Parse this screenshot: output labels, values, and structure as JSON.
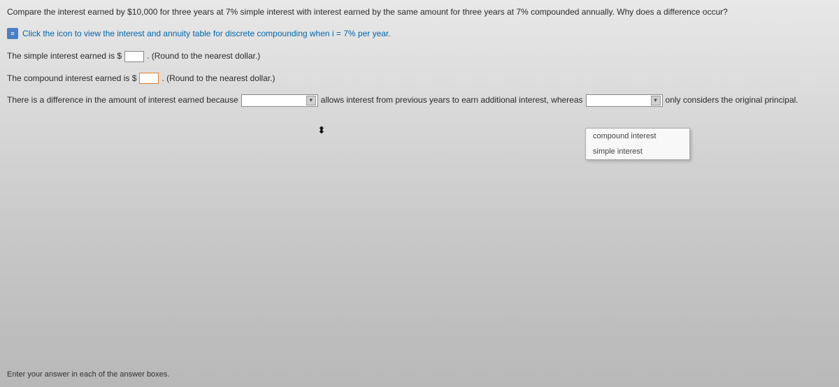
{
  "question": "Compare the interest earned by $10,000 for three years at 7% simple interest with interest earned by the same amount for three years at 7% compounded annually. Why does a difference occur?",
  "link": {
    "text": "Click the icon to view the interest and annuity table for discrete compounding when i = 7% per year."
  },
  "lines": {
    "simple_prefix": "The simple interest earned is $",
    "simple_suffix": ". (Round to the nearest dollar.)",
    "compound_prefix": "The compound interest earned is $",
    "compound_suffix": ". (Round to the nearest dollar.)",
    "diff_prefix": "There is a difference in the amount of interest earned because",
    "diff_mid": "allows interest from previous years to earn additional interest, whereas",
    "diff_suffix": "only considers the original principal."
  },
  "dropdown": {
    "options": [
      "compound interest",
      "simple interest"
    ]
  },
  "footer": "Enter your answer in each of the answer boxes."
}
